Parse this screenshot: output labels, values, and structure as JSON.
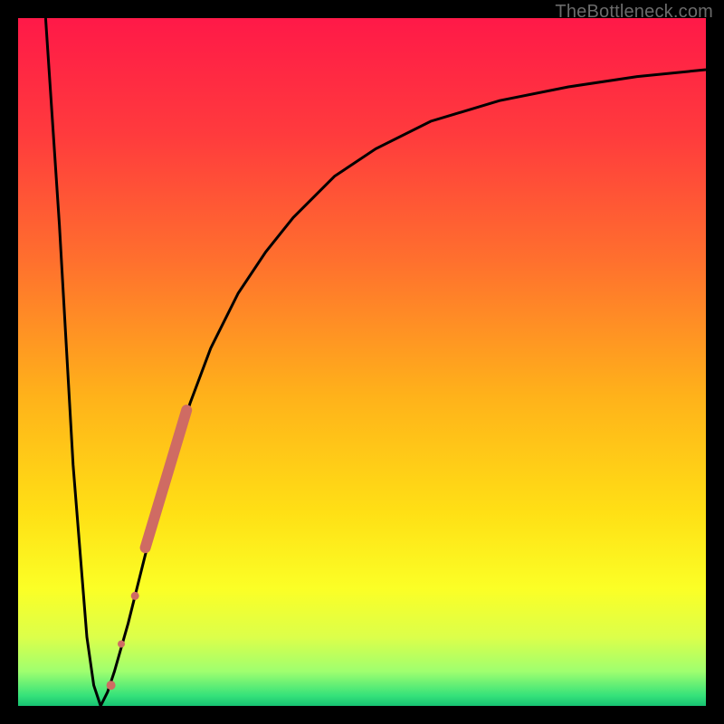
{
  "attribution": "TheBottleneck.com",
  "colors": {
    "frame": "#000000",
    "curve": "#000000",
    "marker": "#cf6b63",
    "gradient_stops": [
      {
        "offset": 0.0,
        "color": "#ff1948"
      },
      {
        "offset": 0.17,
        "color": "#ff3b3d"
      },
      {
        "offset": 0.35,
        "color": "#ff6f2e"
      },
      {
        "offset": 0.55,
        "color": "#ffb21a"
      },
      {
        "offset": 0.72,
        "color": "#ffe015"
      },
      {
        "offset": 0.83,
        "color": "#fbff26"
      },
      {
        "offset": 0.9,
        "color": "#dcff4a"
      },
      {
        "offset": 0.95,
        "color": "#9fff6f"
      },
      {
        "offset": 0.985,
        "color": "#35e27a"
      },
      {
        "offset": 1.0,
        "color": "#17c272"
      }
    ]
  },
  "chart_data": {
    "type": "line",
    "title": "",
    "xlabel": "",
    "ylabel": "",
    "xlim": [
      0,
      100
    ],
    "ylim": [
      0,
      100
    ],
    "series": [
      {
        "name": "bottleneck-curve",
        "x": [
          4,
          6,
          8,
          10,
          11,
          12,
          13,
          14,
          16,
          18,
          20,
          22,
          25,
          28,
          32,
          36,
          40,
          46,
          52,
          60,
          70,
          80,
          90,
          100
        ],
        "y": [
          100,
          70,
          35,
          10,
          3,
          0,
          2,
          5,
          12,
          20,
          28,
          35,
          44,
          52,
          60,
          66,
          71,
          77,
          81,
          85,
          88,
          90,
          91.5,
          92.5
        ]
      }
    ],
    "markers": [
      {
        "name": "segment-thick",
        "x_start": 18.5,
        "y_start": 23,
        "x_end": 24.5,
        "y_end": 43,
        "width": 12
      },
      {
        "name": "dot-mid",
        "x": 17.0,
        "y": 16,
        "r": 4.5
      },
      {
        "name": "dot-low",
        "x": 15.0,
        "y": 9,
        "r": 4.0
      },
      {
        "name": "dot-bottom",
        "x": 13.5,
        "y": 3,
        "r": 5.0
      }
    ]
  }
}
